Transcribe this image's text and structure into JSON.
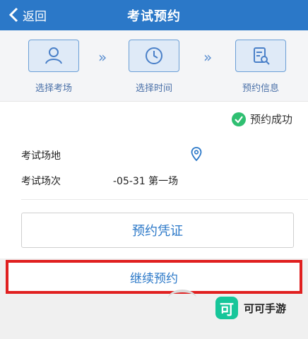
{
  "header": {
    "back_label": "返回",
    "title": "考试预约"
  },
  "steps": [
    {
      "label": "选择考场",
      "icon": "person-icon"
    },
    {
      "label": "选择时间",
      "icon": "clock-icon"
    },
    {
      "label": "预约信息",
      "icon": "document-search-icon"
    }
  ],
  "step_separator": "»",
  "status": {
    "label": "预约成功",
    "color": "#2fbf71"
  },
  "info": {
    "venue_label": "考试场地",
    "venue_value": "",
    "session_label": "考试场次",
    "session_value": "-05-31 第一场"
  },
  "buttons": {
    "voucher": "预约凭证",
    "continue": "继续预约"
  },
  "watermark": {
    "logo_char": "可",
    "text": "可可手游"
  },
  "colors": {
    "primary": "#2b78c8",
    "highlight": "#e02020"
  }
}
